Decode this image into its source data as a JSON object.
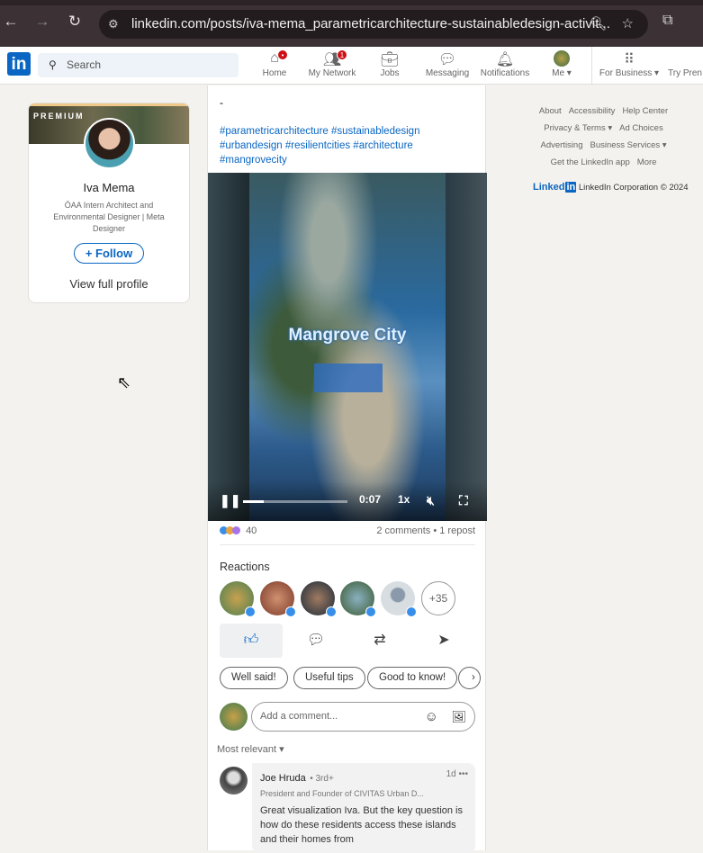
{
  "browser": {
    "url": "linkedin.com/posts/iva-mema_parametricarchitecture-sustainabledesign-activit..."
  },
  "nav": {
    "search_placeholder": "Search",
    "items": [
      {
        "label": "Home",
        "badge": ""
      },
      {
        "label": "My Network",
        "badge": "1"
      },
      {
        "label": "Jobs"
      },
      {
        "label": "Messaging"
      },
      {
        "label": "Notifications"
      },
      {
        "label": "Me ▾"
      },
      {
        "label": "For Business ▾"
      },
      {
        "label": "Try Pren"
      }
    ]
  },
  "profile": {
    "premium": "PREMIUM",
    "name": "Iva Mema",
    "headline": "ÖAA Intern Architect and Environmental Designer | Meta Designer",
    "follow": "+ Follow",
    "view": "View full profile"
  },
  "post": {
    "text": "-",
    "hashtags": "#parametricarchitecture #sustainabledesign #urbandesign #resilientcities #architecture #mangrovecity",
    "video_title": "Mangrove City",
    "video_time": "0:07",
    "video_speed": "1x",
    "video_progress": 0.2,
    "reaction_count": "40",
    "comments_reposts": "2 comments • 1 repost",
    "reactions_heading": "Reactions",
    "more_reactors": "+35",
    "chips": [
      "Well said!",
      "Useful tips",
      "Good to know!"
    ],
    "comment_placeholder": "Add a comment...",
    "sort": "Most relevant ▾"
  },
  "comment": {
    "author": "Joe Hruda",
    "degree": "• 3rd+",
    "time": "1d •••",
    "subtitle": "President and Founder of CIVITAS Urban D...",
    "text": "Great visualization Iva. But the key question is how do these residents access these islands and their homes from"
  },
  "footer": {
    "links": [
      "About",
      "Accessibility",
      "Help Center",
      "Privacy & Terms ▾",
      "Ad Choices",
      "Advertising",
      "Business Services ▾",
      "Get the LinkedIn app",
      "More"
    ],
    "brand": "Linked",
    "copyright": "LinkedIn Corporation © 2024"
  },
  "colors": {
    "brand": "#0a66c2",
    "bg": "#f4f2ee"
  }
}
